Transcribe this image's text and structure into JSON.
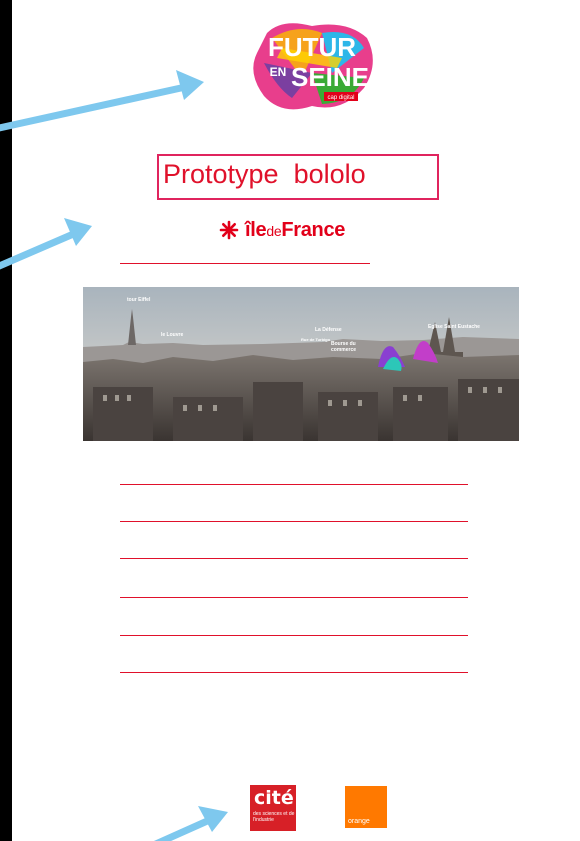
{
  "logos": {
    "futur_en_seine": {
      "line1": "FUTUR",
      "line2": "EN",
      "line3": "SEINE",
      "tag": "cap digital"
    },
    "ile_de_france": {
      "part1": "île",
      "part2": "de",
      "part3": "France",
      "icon": "star-burst-icon"
    },
    "cite": {
      "word": "cité",
      "subtitle": "des sciences et de l'industrie"
    },
    "orange": {
      "word": "orange"
    }
  },
  "title": "Prototype  bololo",
  "photo": {
    "labels": {
      "tour_eiffel": "tour Eiffel",
      "louvre": "le Louvre",
      "defense": "La Défense",
      "eglise": "Eglise Saint Eustache",
      "bourse": "Bourse du commerce",
      "rue": "Rue de Turbigo"
    }
  },
  "lines_count": 7,
  "colors": {
    "accent_red": "#e0112b",
    "arrow_blue": "#7ec8ee",
    "idf_red": "#e2001a",
    "orange": "#ff7900",
    "cite_red": "#d72027"
  }
}
